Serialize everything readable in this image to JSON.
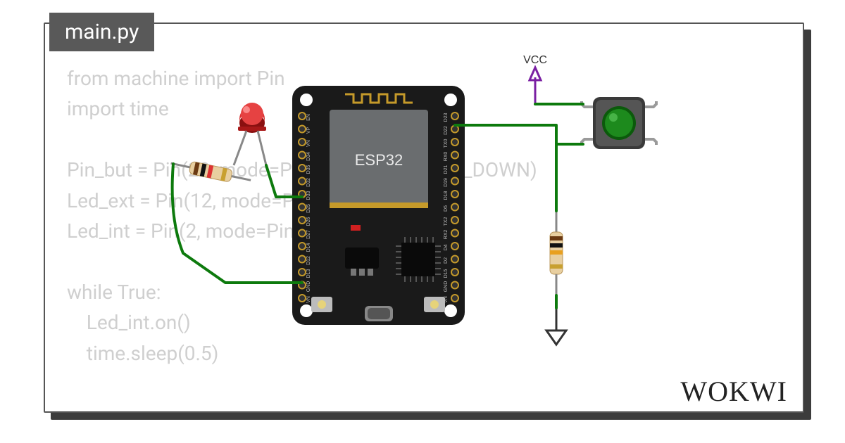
{
  "tab": {
    "title": "main.py"
  },
  "code": {
    "text": "from machine import Pin\nimport time\n\nPin_but = Pin(22, mode=Pin.IN, pull=Pin.PULL_DOWN)\nLed_ext = Pin(12, mode=Pin.OUT)\nLed_int = Pin(2, mode=Pin.OUT)\n\nwhile True:\n    Led_int.on()\n    time.sleep(0.5)"
  },
  "board": {
    "label": "ESP32",
    "pin_top_labels": [
      "VN",
      "GND",
      "D13",
      "D12",
      "D14",
      "D27",
      "D26",
      "D25",
      "D33",
      "D32",
      "D35",
      "D34",
      "VN",
      "VP",
      "EN"
    ],
    "pin_bot_labels": [
      "VN",
      "GND",
      "D15",
      "D2",
      "D4",
      "RX2",
      "TX2",
      "D5",
      "D18",
      "D19",
      "D21",
      "RX0",
      "TX0",
      "D22",
      "D23"
    ]
  },
  "labels": {
    "vcc": "VCC"
  },
  "brand": "WOKWI",
  "colors": {
    "wire": "#0d7a0d",
    "led_cap": "#c32020",
    "button_cap": "#1d8a1d",
    "board": "#1a1a1a",
    "module": "#6a6d6f"
  }
}
